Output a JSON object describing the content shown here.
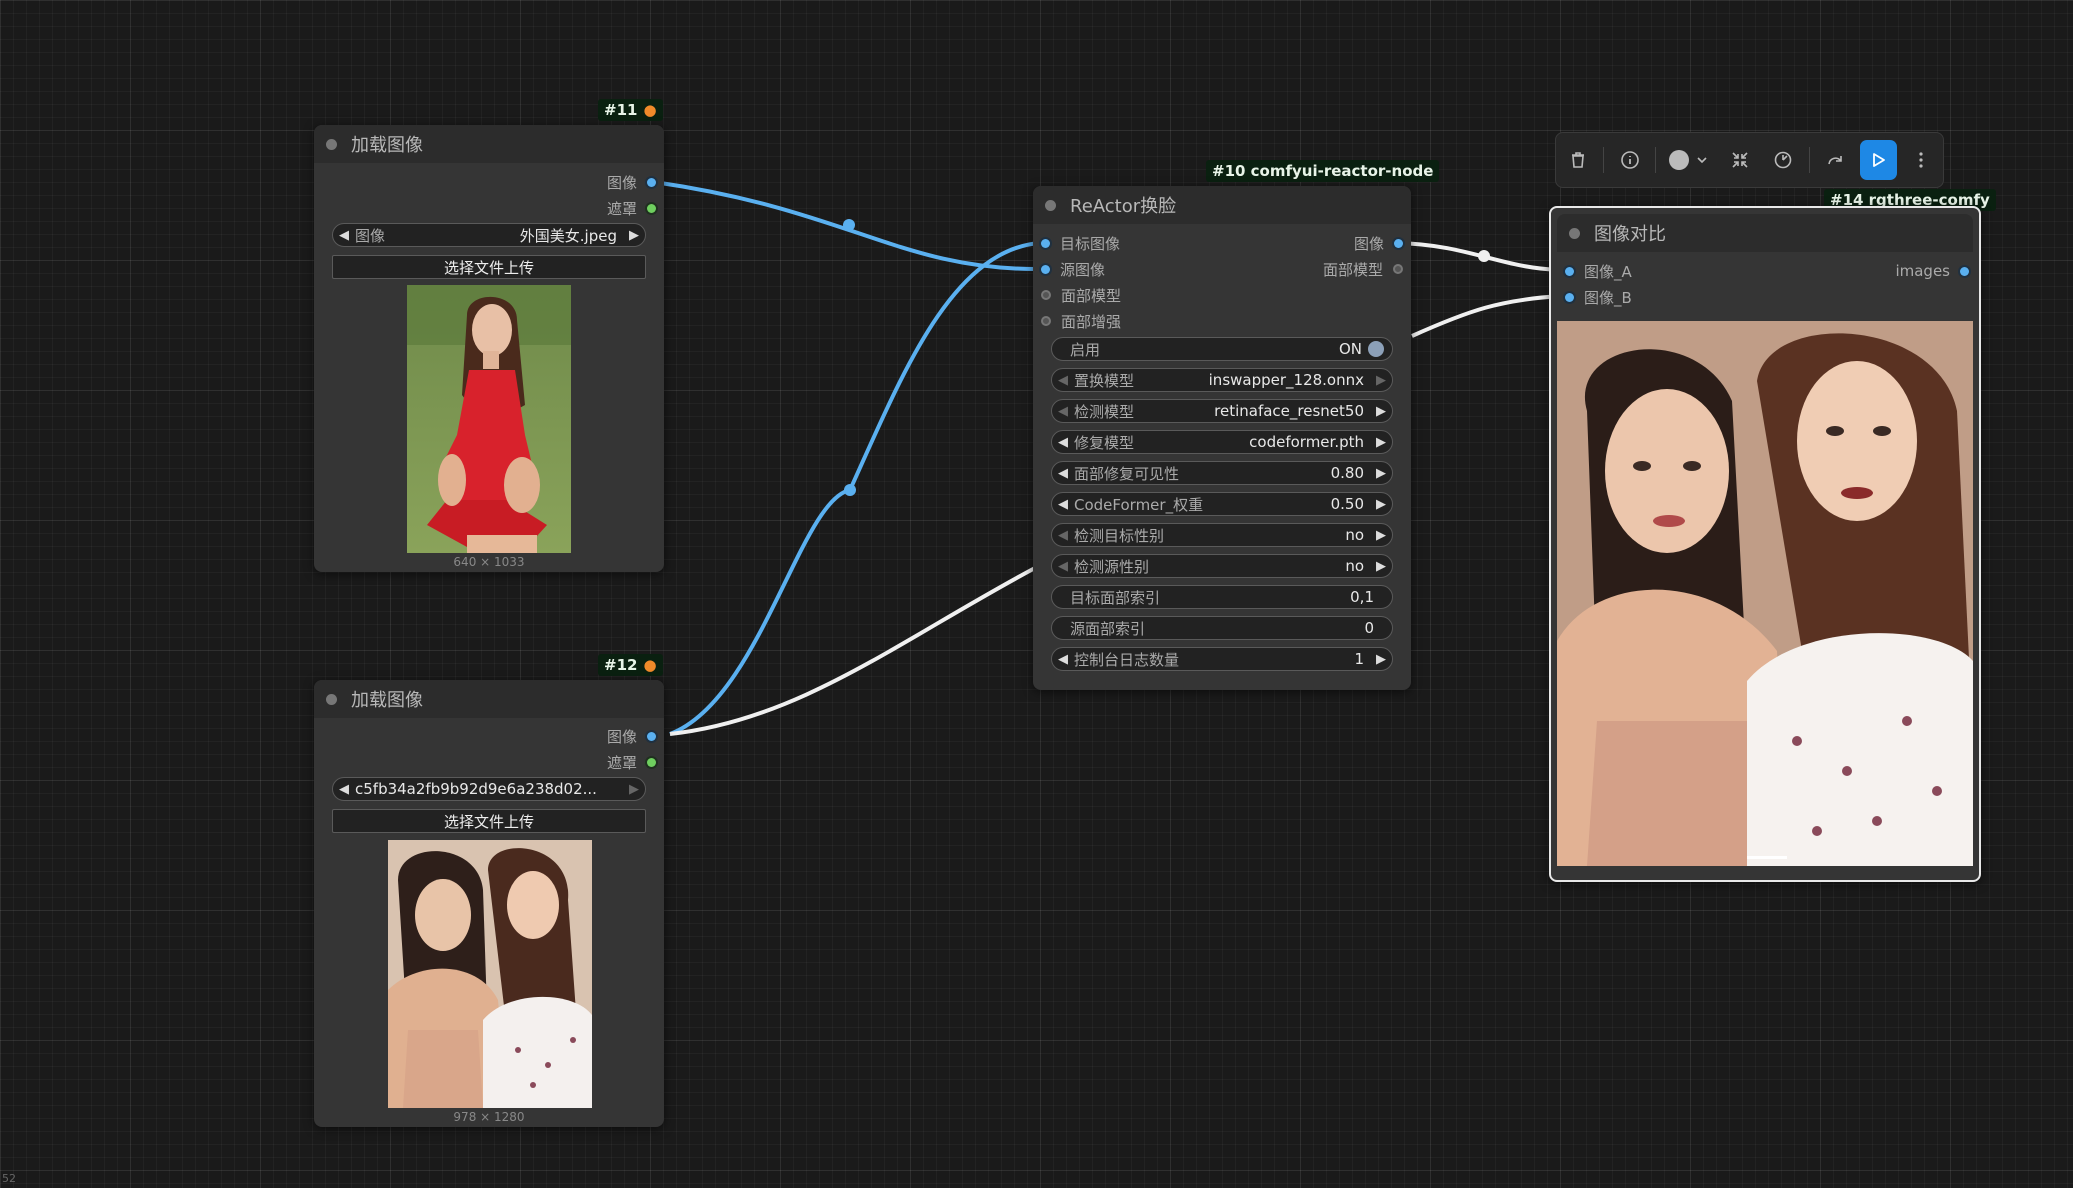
{
  "node11": {
    "badge": "#11",
    "title": "加载图像",
    "out_image": "图像",
    "out_mask": "遮罩",
    "widget_label": "图像",
    "widget_value": "外国美女.jpeg",
    "upload_label": "选择文件上传",
    "size": "640 × 1033"
  },
  "node12": {
    "badge": "#12",
    "title": "加载图像",
    "out_image": "图像",
    "out_mask": "遮罩",
    "widget_value": "c5fb34a2fb9b92d9e6a238d02...",
    "upload_label": "选择文件上传",
    "size": "978 × 1280"
  },
  "node10": {
    "badge": "#10 comfyui-reactor-node",
    "title": "ReActor换脸",
    "in_target": "目标图像",
    "in_source": "源图像",
    "in_face_model": "面部模型",
    "in_face_boost": "面部增强",
    "out_image": "图像",
    "out_face_model": "面部模型",
    "widgets": [
      {
        "label": "启用",
        "value": "ON",
        "type": "toggle"
      },
      {
        "label": "置换模型",
        "value": "inswapper_128.onnx",
        "type": "combo-dim"
      },
      {
        "label": "检测模型",
        "value": "retinaface_resnet50",
        "type": "combo-dim"
      },
      {
        "label": "修复模型",
        "value": "codeformer.pth",
        "type": "combo"
      },
      {
        "label": "面部修复可见性",
        "value": "0.80",
        "type": "combo"
      },
      {
        "label": "CodeFormer_权重",
        "value": "0.50",
        "type": "combo"
      },
      {
        "label": "检测目标性别",
        "value": "no",
        "type": "combo-dim"
      },
      {
        "label": "检测源性别",
        "value": "no",
        "type": "combo-dim"
      },
      {
        "label": "目标面部索引",
        "value": "0,1",
        "type": "text"
      },
      {
        "label": "源面部索引",
        "value": "0",
        "type": "text"
      },
      {
        "label": "控制台日志数量",
        "value": "1",
        "type": "combo"
      }
    ]
  },
  "node14": {
    "badge": "#14 rgthree-comfy",
    "title": "图像对比",
    "in_a": "图像_A",
    "in_b": "图像_B",
    "out_images": "images"
  },
  "toolbar": {
    "icons": [
      "trash-icon",
      "info-icon",
      "color-circle-icon",
      "chevron-down-icon",
      "collapse-icon",
      "bypass-icon",
      "redo-icon",
      "run-icon",
      "more-icon"
    ]
  },
  "corner_text": "52",
  "colors": {
    "link_blue": "#5ab0f0",
    "link_white": "#f0f0f0",
    "run_button": "#1e88e5",
    "node_bg": "#353535",
    "canvas_bg": "#1a1a1a"
  }
}
